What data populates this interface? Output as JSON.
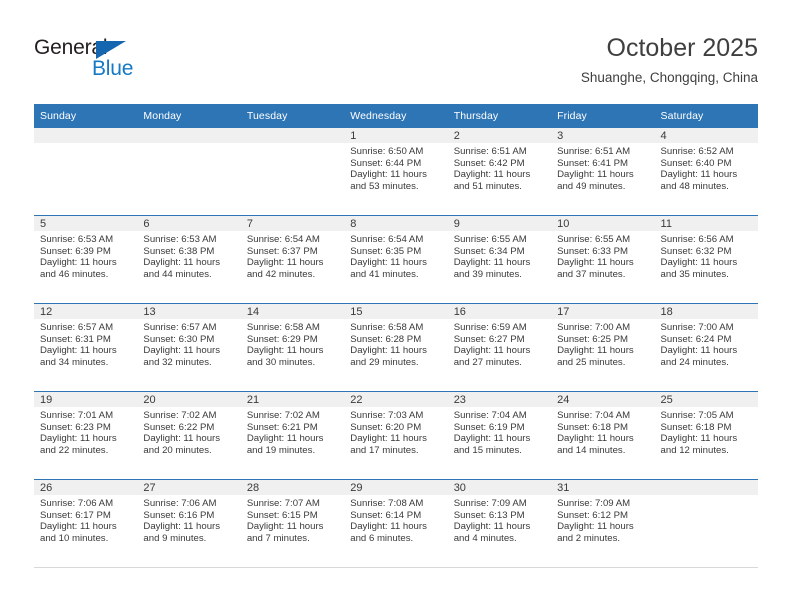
{
  "brand": {
    "name_top": "General",
    "name_bottom": "Blue",
    "triangle_color": "#1566b0",
    "blue_color": "#1679c4",
    "dark_color": "#231f20"
  },
  "header": {
    "title": "October 2025",
    "subtitle": "Shuanghe, Chongqing, China",
    "accent_color": "#2e75b6",
    "daynum_band_color": "#f0f0f0"
  },
  "weekday_headers": [
    "Sunday",
    "Monday",
    "Tuesday",
    "Wednesday",
    "Thursday",
    "Friday",
    "Saturday"
  ],
  "labels": {
    "sunrise_prefix": "Sunrise:",
    "sunset_prefix": "Sunset:",
    "daylight_prefix": "Daylight:"
  },
  "weeks": [
    [
      {
        "day": "",
        "empty": true
      },
      {
        "day": "",
        "empty": true
      },
      {
        "day": "",
        "empty": true
      },
      {
        "day": "1",
        "sunrise": "Sunrise: 6:50 AM",
        "sunset": "Sunset: 6:44 PM",
        "daylight_line1": "Daylight: 11 hours",
        "daylight_line2": "and 53 minutes."
      },
      {
        "day": "2",
        "sunrise": "Sunrise: 6:51 AM",
        "sunset": "Sunset: 6:42 PM",
        "daylight_line1": "Daylight: 11 hours",
        "daylight_line2": "and 51 minutes."
      },
      {
        "day": "3",
        "sunrise": "Sunrise: 6:51 AM",
        "sunset": "Sunset: 6:41 PM",
        "daylight_line1": "Daylight: 11 hours",
        "daylight_line2": "and 49 minutes."
      },
      {
        "day": "4",
        "sunrise": "Sunrise: 6:52 AM",
        "sunset": "Sunset: 6:40 PM",
        "daylight_line1": "Daylight: 11 hours",
        "daylight_line2": "and 48 minutes."
      }
    ],
    [
      {
        "day": "5",
        "sunrise": "Sunrise: 6:53 AM",
        "sunset": "Sunset: 6:39 PM",
        "daylight_line1": "Daylight: 11 hours",
        "daylight_line2": "and 46 minutes."
      },
      {
        "day": "6",
        "sunrise": "Sunrise: 6:53 AM",
        "sunset": "Sunset: 6:38 PM",
        "daylight_line1": "Daylight: 11 hours",
        "daylight_line2": "and 44 minutes."
      },
      {
        "day": "7",
        "sunrise": "Sunrise: 6:54 AM",
        "sunset": "Sunset: 6:37 PM",
        "daylight_line1": "Daylight: 11 hours",
        "daylight_line2": "and 42 minutes."
      },
      {
        "day": "8",
        "sunrise": "Sunrise: 6:54 AM",
        "sunset": "Sunset: 6:35 PM",
        "daylight_line1": "Daylight: 11 hours",
        "daylight_line2": "and 41 minutes."
      },
      {
        "day": "9",
        "sunrise": "Sunrise: 6:55 AM",
        "sunset": "Sunset: 6:34 PM",
        "daylight_line1": "Daylight: 11 hours",
        "daylight_line2": "and 39 minutes."
      },
      {
        "day": "10",
        "sunrise": "Sunrise: 6:55 AM",
        "sunset": "Sunset: 6:33 PM",
        "daylight_line1": "Daylight: 11 hours",
        "daylight_line2": "and 37 minutes."
      },
      {
        "day": "11",
        "sunrise": "Sunrise: 6:56 AM",
        "sunset": "Sunset: 6:32 PM",
        "daylight_line1": "Daylight: 11 hours",
        "daylight_line2": "and 35 minutes."
      }
    ],
    [
      {
        "day": "12",
        "sunrise": "Sunrise: 6:57 AM",
        "sunset": "Sunset: 6:31 PM",
        "daylight_line1": "Daylight: 11 hours",
        "daylight_line2": "and 34 minutes."
      },
      {
        "day": "13",
        "sunrise": "Sunrise: 6:57 AM",
        "sunset": "Sunset: 6:30 PM",
        "daylight_line1": "Daylight: 11 hours",
        "daylight_line2": "and 32 minutes."
      },
      {
        "day": "14",
        "sunrise": "Sunrise: 6:58 AM",
        "sunset": "Sunset: 6:29 PM",
        "daylight_line1": "Daylight: 11 hours",
        "daylight_line2": "and 30 minutes."
      },
      {
        "day": "15",
        "sunrise": "Sunrise: 6:58 AM",
        "sunset": "Sunset: 6:28 PM",
        "daylight_line1": "Daylight: 11 hours",
        "daylight_line2": "and 29 minutes."
      },
      {
        "day": "16",
        "sunrise": "Sunrise: 6:59 AM",
        "sunset": "Sunset: 6:27 PM",
        "daylight_line1": "Daylight: 11 hours",
        "daylight_line2": "and 27 minutes."
      },
      {
        "day": "17",
        "sunrise": "Sunrise: 7:00 AM",
        "sunset": "Sunset: 6:25 PM",
        "daylight_line1": "Daylight: 11 hours",
        "daylight_line2": "and 25 minutes."
      },
      {
        "day": "18",
        "sunrise": "Sunrise: 7:00 AM",
        "sunset": "Sunset: 6:24 PM",
        "daylight_line1": "Daylight: 11 hours",
        "daylight_line2": "and 24 minutes."
      }
    ],
    [
      {
        "day": "19",
        "sunrise": "Sunrise: 7:01 AM",
        "sunset": "Sunset: 6:23 PM",
        "daylight_line1": "Daylight: 11 hours",
        "daylight_line2": "and 22 minutes."
      },
      {
        "day": "20",
        "sunrise": "Sunrise: 7:02 AM",
        "sunset": "Sunset: 6:22 PM",
        "daylight_line1": "Daylight: 11 hours",
        "daylight_line2": "and 20 minutes."
      },
      {
        "day": "21",
        "sunrise": "Sunrise: 7:02 AM",
        "sunset": "Sunset: 6:21 PM",
        "daylight_line1": "Daylight: 11 hours",
        "daylight_line2": "and 19 minutes."
      },
      {
        "day": "22",
        "sunrise": "Sunrise: 7:03 AM",
        "sunset": "Sunset: 6:20 PM",
        "daylight_line1": "Daylight: 11 hours",
        "daylight_line2": "and 17 minutes."
      },
      {
        "day": "23",
        "sunrise": "Sunrise: 7:04 AM",
        "sunset": "Sunset: 6:19 PM",
        "daylight_line1": "Daylight: 11 hours",
        "daylight_line2": "and 15 minutes."
      },
      {
        "day": "24",
        "sunrise": "Sunrise: 7:04 AM",
        "sunset": "Sunset: 6:18 PM",
        "daylight_line1": "Daylight: 11 hours",
        "daylight_line2": "and 14 minutes."
      },
      {
        "day": "25",
        "sunrise": "Sunrise: 7:05 AM",
        "sunset": "Sunset: 6:18 PM",
        "daylight_line1": "Daylight: 11 hours",
        "daylight_line2": "and 12 minutes."
      }
    ],
    [
      {
        "day": "26",
        "sunrise": "Sunrise: 7:06 AM",
        "sunset": "Sunset: 6:17 PM",
        "daylight_line1": "Daylight: 11 hours",
        "daylight_line2": "and 10 minutes."
      },
      {
        "day": "27",
        "sunrise": "Sunrise: 7:06 AM",
        "sunset": "Sunset: 6:16 PM",
        "daylight_line1": "Daylight: 11 hours",
        "daylight_line2": "and 9 minutes."
      },
      {
        "day": "28",
        "sunrise": "Sunrise: 7:07 AM",
        "sunset": "Sunset: 6:15 PM",
        "daylight_line1": "Daylight: 11 hours",
        "daylight_line2": "and 7 minutes."
      },
      {
        "day": "29",
        "sunrise": "Sunrise: 7:08 AM",
        "sunset": "Sunset: 6:14 PM",
        "daylight_line1": "Daylight: 11 hours",
        "daylight_line2": "and 6 minutes."
      },
      {
        "day": "30",
        "sunrise": "Sunrise: 7:09 AM",
        "sunset": "Sunset: 6:13 PM",
        "daylight_line1": "Daylight: 11 hours",
        "daylight_line2": "and 4 minutes."
      },
      {
        "day": "31",
        "sunrise": "Sunrise: 7:09 AM",
        "sunset": "Sunset: 6:12 PM",
        "daylight_line1": "Daylight: 11 hours",
        "daylight_line2": "and 2 minutes."
      },
      {
        "day": "",
        "empty": true
      }
    ]
  ]
}
